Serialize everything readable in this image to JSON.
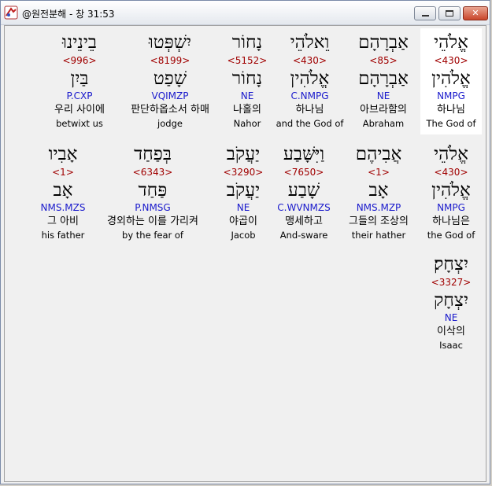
{
  "window": {
    "title": "@원전분해 - 창 31:53",
    "icon": "app-icon"
  },
  "rows": [
    [
      {
        "hebrew": "אֱלֹהֵי",
        "strong": "<430>",
        "lemma": "אֱלֹהִין",
        "parse": "NMPG",
        "korean": "하나님",
        "english": "The God of",
        "selected": true
      },
      {
        "hebrew": "אַבְרָהָם",
        "strong": "<85>",
        "lemma": "אַבְרָהָם",
        "parse": "NE",
        "korean": "아브라함의",
        "english": "Abraham"
      },
      {
        "hebrew": "וֵאלֹהֵי",
        "strong": "<430>",
        "lemma": "אֱלֹהִין",
        "parse": "C.NMPG",
        "korean": "하나님",
        "english": "and the God of"
      },
      {
        "hebrew": "נָחוֹר",
        "strong": "<5152>",
        "lemma": "נָחוֹר",
        "parse": "NE",
        "korean": "나홀의",
        "english": "Nahor"
      },
      {
        "hebrew": "יִשְׁפְּטוּ",
        "strong": "<8199>",
        "lemma": "שָׁפַט",
        "parse": "VQIMZP",
        "korean": "판단하옵소서 하매",
        "english": "jodge"
      },
      {
        "hebrew": "בֵינֵינוּ",
        "strong": "<996>",
        "lemma": "בַּיִן",
        "parse": "P.CXP",
        "korean": "우리 사이에",
        "english": "betwixt us"
      }
    ],
    [
      {
        "hebrew": "אֱלֹהֵי",
        "strong": "<430>",
        "lemma": "אֱלֹהִין",
        "parse": "NMPG",
        "korean": "하나님은",
        "english": "the God of"
      },
      {
        "hebrew": "אֲבִיהֶם",
        "strong": "<1>",
        "lemma": "אָב",
        "parse": "NMS.MZP",
        "korean": "그들의 조상의",
        "english": "their hather"
      },
      {
        "hebrew": "וַיִּשָּׁבַע",
        "strong": "<7650>",
        "lemma": "שָׁבַע",
        "parse": "C.WVNMZS",
        "korean": "맹세하고",
        "english": "And-sware"
      },
      {
        "hebrew": "יַעֲקֹב",
        "strong": "<3290>",
        "lemma": "יַעֲקֹב",
        "parse": "NE",
        "korean": "야곱이",
        "english": "Jacob"
      },
      {
        "hebrew": "בְּפַחַד",
        "strong": "<6343>",
        "lemma": "פַּחַד",
        "parse": "P.NMSG",
        "korean": "경외하는 이를 가리켜",
        "english": "by the fear of"
      },
      {
        "hebrew": "אָבִיו",
        "strong": "<1>",
        "lemma": "אָב",
        "parse": "NMS.MZS",
        "korean": "그 아비",
        "english": "his father"
      }
    ],
    [
      {
        "hebrew": "יִצְחָק׃",
        "strong": "<3327>",
        "lemma": "יִצְחָק",
        "parse": "NE",
        "korean": "이삭의",
        "english": "Isaac"
      }
    ]
  ]
}
